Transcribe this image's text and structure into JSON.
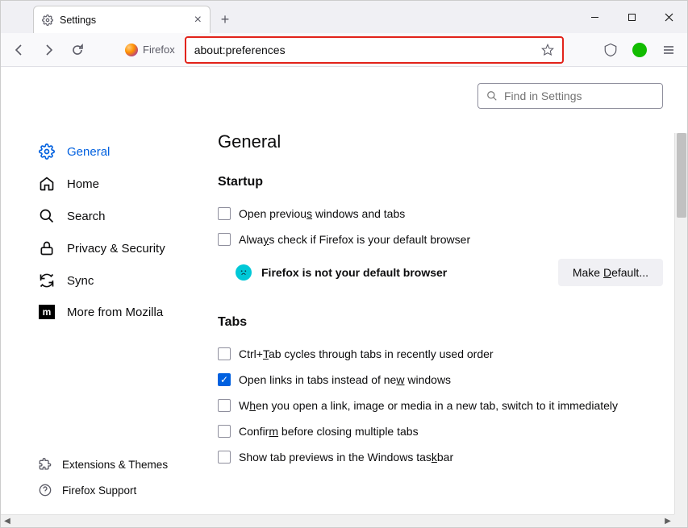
{
  "tab": {
    "title": "Settings"
  },
  "urlbar": {
    "identity": "Firefox",
    "url": "about:preferences"
  },
  "search": {
    "placeholder": "Find in Settings"
  },
  "sidebar": {
    "items": [
      {
        "label": "General"
      },
      {
        "label": "Home"
      },
      {
        "label": "Search"
      },
      {
        "label": "Privacy & Security"
      },
      {
        "label": "Sync"
      },
      {
        "label": "More from Mozilla"
      }
    ],
    "footer": [
      {
        "label": "Extensions & Themes"
      },
      {
        "label": "Firefox Support"
      }
    ]
  },
  "page": {
    "title": "General",
    "startup": {
      "heading": "Startup",
      "open_prev": "Open previous windows and tabs",
      "always_check": "Always check if Firefox is your default browser",
      "not_default": "Firefox is not your default browser",
      "make_default": "Make Default..."
    },
    "tabs": {
      "heading": "Tabs",
      "ctrl_tab": "Ctrl+Tab cycles through tabs in recently used order",
      "open_links": "Open links in tabs instead of new windows",
      "switch_immediate": "When you open a link, image or media in a new tab, switch to it immediately",
      "confirm_close": "Confirm before closing multiple tabs",
      "taskbar_preview": "Show tab previews in the Windows taskbar"
    }
  }
}
